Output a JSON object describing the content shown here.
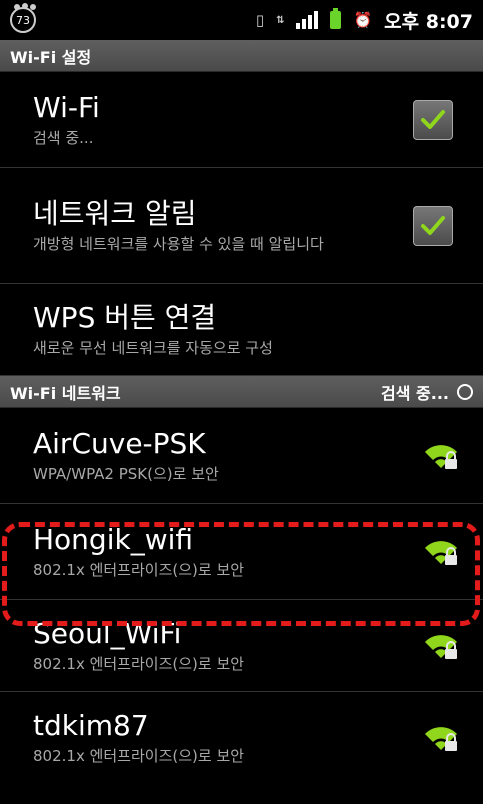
{
  "status_bar": {
    "badge_number": "73",
    "icons": [
      "paw-icon",
      "screen-icon",
      "data-icon",
      "signal-icon",
      "battery-icon",
      "alarm-icon"
    ],
    "time": "오후 8:07",
    "battery_color": "#6bd42a"
  },
  "settings_header": {
    "label": "Wi-Fi 설정"
  },
  "settings": [
    {
      "title": "Wi-Fi",
      "subtitle": "검색 중...",
      "checked": true
    },
    {
      "title": "네트워크 알림",
      "subtitle": "개방형 네트워크를 사용할 수 있을 때 알립니다",
      "checked": true
    },
    {
      "title": "WPS 버튼 연결",
      "subtitle": "새로운 무선 네트워크를 자동으로 구성"
    }
  ],
  "networks_header": {
    "label": "Wi-Fi 네트워크",
    "status": "검색 중..."
  },
  "networks": [
    {
      "ssid": "AirCuve-PSK",
      "security": "WPA/WPA2 PSK(으)로 보안"
    },
    {
      "ssid": "Hongik_wifi",
      "security": "802.1x 엔터프라이즈(으)로 보안"
    },
    {
      "ssid": "Seoul_WiFi",
      "security": "802.1x 엔터프라이즈(으)로 보안"
    },
    {
      "ssid": "tdkim87",
      "security": "802.1x 엔터프라이즈(으)로 보안"
    }
  ],
  "colors": {
    "highlight": "#e41b1b",
    "signal": "#8fd61c",
    "check": "#8fd61c"
  }
}
